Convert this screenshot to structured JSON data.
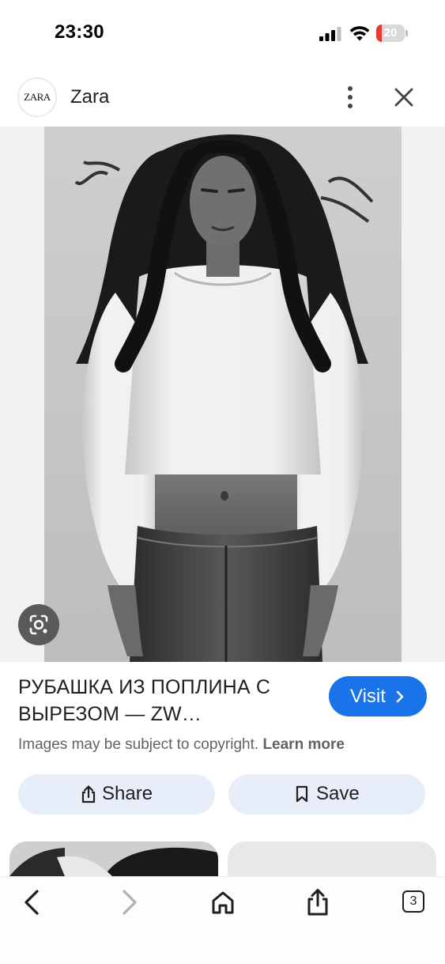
{
  "status_bar": {
    "time": "23:30",
    "battery_level": "20",
    "battery_fraction": 0.2,
    "battery_color": "#e53b30"
  },
  "header": {
    "logo_text": "ZARA",
    "site_name": "Zara"
  },
  "result": {
    "title": "РУБАШКА ИЗ ПОПЛИНА С ВЫРЕЗОМ — ZW…",
    "visit_label": "Visit",
    "copyright_text": "Images may be subject to copyright.",
    "learn_more_label": "Learn more"
  },
  "actions": {
    "share_label": "Share",
    "save_label": "Save"
  },
  "bottom_nav": {
    "tab_count": "3"
  },
  "colors": {
    "accent": "#1a73e8",
    "action_bg": "#e8eef9"
  },
  "icons": [
    "more-vertical-icon",
    "close-icon",
    "google-lens-icon",
    "chevron-right-icon",
    "share-icon",
    "bookmark-icon",
    "back-arrow-icon",
    "forward-arrow-icon",
    "home-icon",
    "share-nav-icon"
  ]
}
